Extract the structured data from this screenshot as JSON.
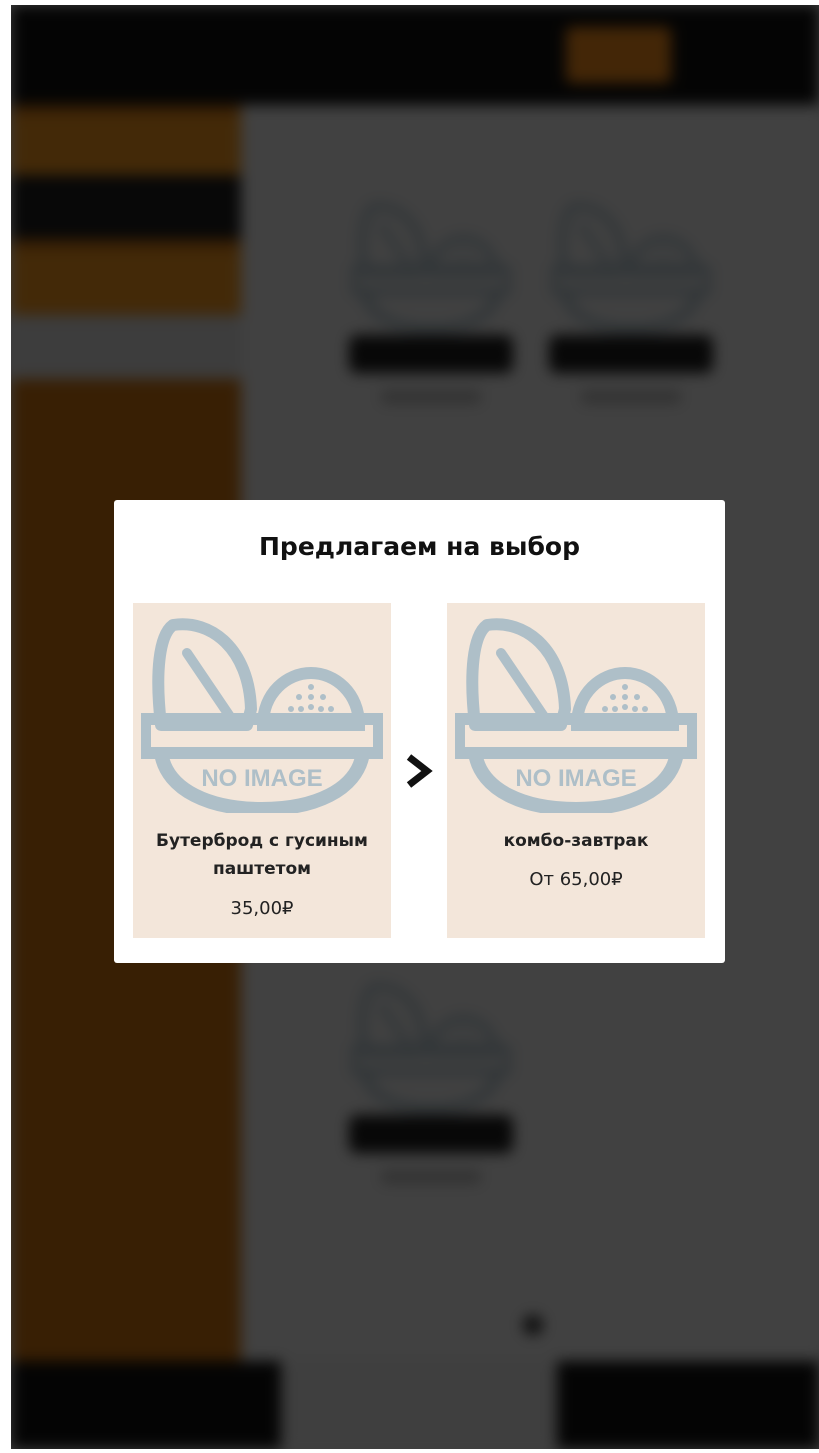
{
  "header": {
    "title": "",
    "accent_button": "",
    "right_button": ""
  },
  "sidebar": {
    "items": [
      {
        "label": ""
      },
      {
        "label": ""
      },
      {
        "label": ""
      },
      {
        "label": ""
      },
      {
        "label": ""
      },
      {
        "label": ""
      }
    ]
  },
  "footer": {
    "left_button": "",
    "middle": "",
    "right_button": "",
    "total": ""
  },
  "modal": {
    "title": "Предлагаем на выбор",
    "options": [
      {
        "name": "Бутерброд с гусиным паштетом",
        "price": "35,00₽",
        "image_text": "NO IMAGE",
        "icon": "no-image-bowl-icon"
      },
      {
        "name": "комбо-завтрак",
        "price": "От 65,00₽",
        "image_text": "NO IMAGE",
        "icon": "no-image-bowl-icon"
      }
    ],
    "arrow_icon": "chevron-right-icon"
  },
  "colors": {
    "accent_orange": "#f08a1c",
    "sidebar_orange": "#c97010",
    "card_background": "#f3e6da",
    "placeholder_gray": "#aebfc8",
    "overlay": "rgba(0,0,0,0.72)"
  }
}
